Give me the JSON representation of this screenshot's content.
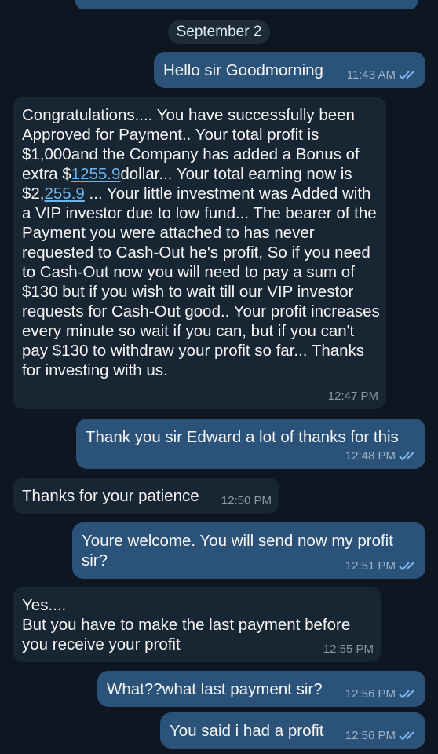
{
  "date_separator": "September 2",
  "messages": [
    {
      "dir": "out",
      "text": "Hello sir Goodmorning",
      "time": "11:43 AM"
    },
    {
      "dir": "in",
      "parts": [
        "Congratulations.... You have successfully been Approved for Payment.. Your total profit is $1,000and the Company has added a Bonus of extra $",
        "1255.9",
        "dollar... Your total earning now is $2,",
        "255.9",
        " ... Your little investment was Added with a VIP investor due to low fund... The bearer of the Payment you were attached to has never requested to Cash-Out he's profit, So if you need to Cash-Out now you will need to pay a sum of $130 but if you wish to wait till our VIP investor requests for Cash-Out good.. Your profit increases every minute so wait if you can, but if you can't pay $130 to withdraw your profit so far... Thanks for investing with us."
      ],
      "time": "12:47 PM"
    },
    {
      "dir": "out",
      "text": "Thank you sir Edward a lot of thanks for this",
      "time": "12:48 PM"
    },
    {
      "dir": "in",
      "text": "Thanks for your patience",
      "time": "12:50 PM"
    },
    {
      "dir": "out",
      "text": "Youre welcome. You will send now my profit sir?",
      "time": "12:51 PM"
    },
    {
      "dir": "in",
      "line1": "Yes....",
      "line2": "But you have to make the last payment before you receive your profit",
      "time": "12:55 PM"
    },
    {
      "dir": "out",
      "text": "What??what last payment sir?",
      "time": "12:56 PM"
    },
    {
      "dir": "out",
      "text": "You said i had a profit",
      "time": "12:56 PM"
    }
  ],
  "colors": {
    "background": "#0e1621",
    "outgoing": "#2b5278",
    "incoming": "#182533",
    "read_check": "#7fb8ee"
  },
  "icons": {
    "read_receipt": "double-check-icon"
  }
}
